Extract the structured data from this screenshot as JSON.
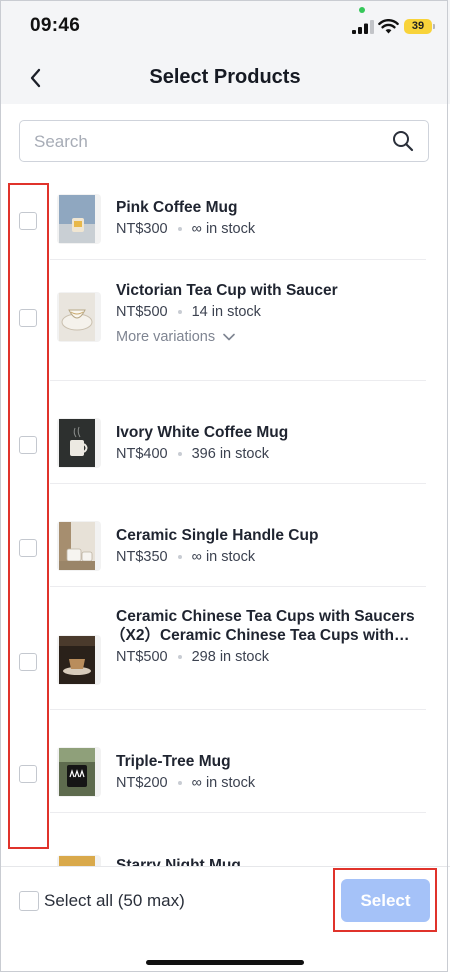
{
  "status_bar": {
    "time": "09:46",
    "battery": "39",
    "battery_color": "#f8d33a"
  },
  "header": {
    "title": "Select Products",
    "back_icon": "chevron-left-icon"
  },
  "search": {
    "placeholder": "Search",
    "value": "",
    "icon": "search-icon"
  },
  "products": [
    {
      "name": "Pink Coffee Mug",
      "price": "NT$300",
      "stock": "∞ in stock"
    },
    {
      "name": "Victorian Tea Cup with Saucer",
      "price": "NT$500",
      "stock": "14 in stock",
      "more_variations": "More variations"
    },
    {
      "name": "Ivory White Coffee Mug",
      "price": "NT$400",
      "stock": "396 in stock"
    },
    {
      "name": "Ceramic Single Handle Cup",
      "price": "NT$350",
      "stock": "∞ in stock"
    },
    {
      "name_line1": "Ceramic Chinese Tea Cups with Saucers",
      "name_line2": "（X2）Ceramic Chinese Tea Cups with…",
      "price": "NT$500",
      "stock": "298 in stock"
    },
    {
      "name": "Triple-Tree Mug",
      "price": "NT$200",
      "stock": "∞ in stock"
    },
    {
      "name": "Starry Night Mug"
    }
  ],
  "footer": {
    "select_all_label": "Select all (50 max)",
    "select_button": "Select"
  },
  "colors": {
    "accent_disabled": "#a5c2f8",
    "highlight": "#e0332b"
  }
}
